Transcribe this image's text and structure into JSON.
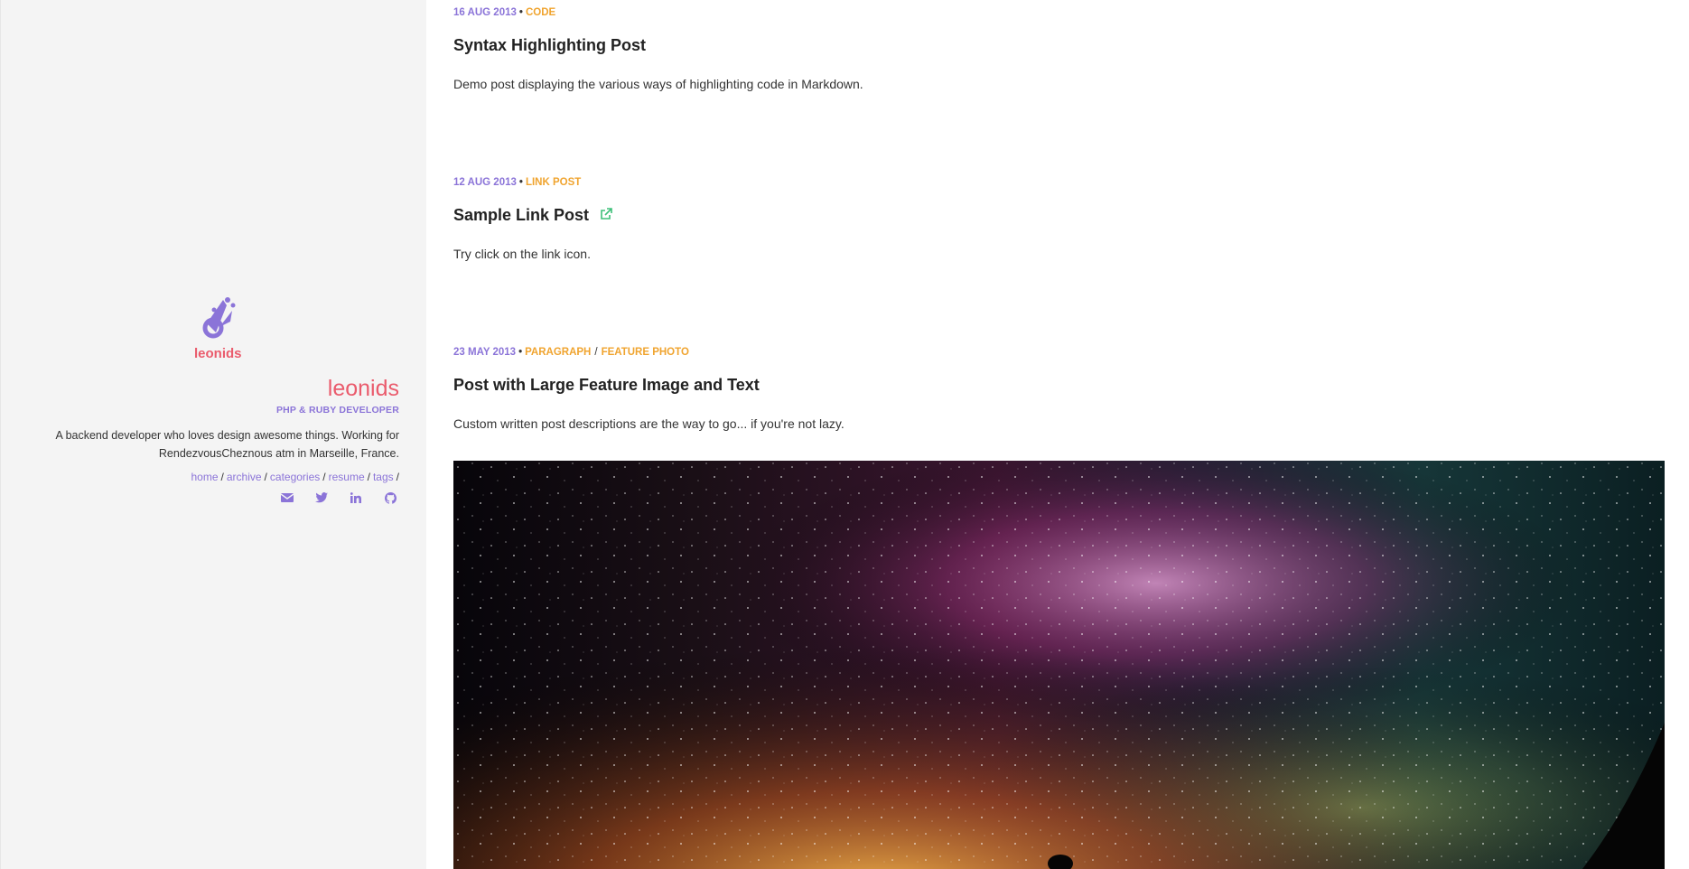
{
  "sidebar": {
    "logo_text": "leonids",
    "site_title": "leonids",
    "tagline": "PHP & RUBY DEVELOPER",
    "bio_line1": "A backend developer who loves design awesome things. Working for",
    "bio_line2": "RendezvousCheznous atm in Marseille, France.",
    "nav": [
      {
        "label": "home"
      },
      {
        "label": "archive"
      },
      {
        "label": "categories"
      },
      {
        "label": "resume"
      },
      {
        "label": "tags"
      }
    ],
    "nav_separator": "/",
    "social": [
      {
        "icon": "envelope-icon"
      },
      {
        "icon": "twitter-icon"
      },
      {
        "icon": "linkedin-icon"
      },
      {
        "icon": "github-icon"
      }
    ],
    "colors": {
      "accent_red": "#ea5b6c",
      "accent_purple": "#8b74d8",
      "accent_orange": "#f0a42f"
    }
  },
  "posts": [
    {
      "date": "16 AUG 2013",
      "categories": [
        "CODE"
      ],
      "title": "Syntax Highlighting Post",
      "description": "Demo post displaying the various ways of highlighting code in Markdown."
    },
    {
      "date": "12 AUG 2013",
      "categories": [
        "LINK POST"
      ],
      "title": "Sample Link Post",
      "description": "Try click on the link icon."
    },
    {
      "date": "23 MAY 2013",
      "categories": [
        "PARAGRAPH",
        "FEATURE PHOTO"
      ],
      "title": "Post with Large Feature Image and Text",
      "description": "Custom written post descriptions are the way to go... if you're not lazy."
    }
  ],
  "meta_bullet": "•"
}
